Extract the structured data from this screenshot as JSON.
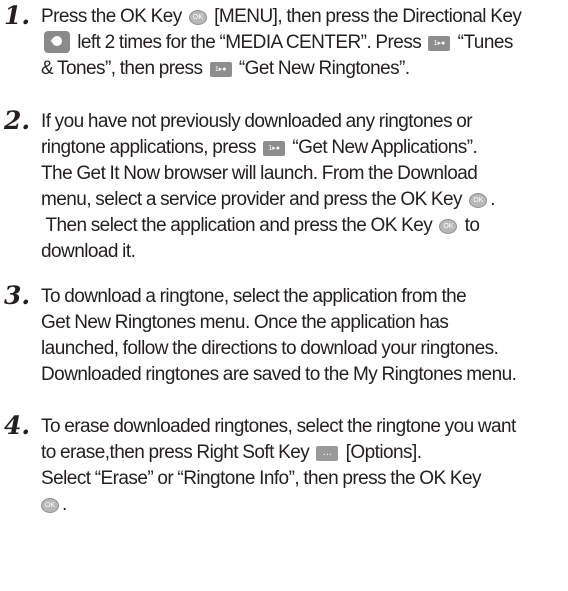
{
  "icons": {
    "ok_key": "ok-key-icon",
    "directional_key": "directional-key-icon",
    "number_key": "number-1-key-icon",
    "right_soft_key": "right-soft-key-icon"
  },
  "steps": [
    {
      "number": "1.",
      "l1a": "Press the OK Key ",
      "l1b": " [MENU], then press the Directional Key",
      "l2a": " left 2 times for the “MEDIA CENTER”. Press ",
      "l2b": " “Tunes",
      "l3a": "& Tones”, then press ",
      "l3b": " “Get New Ringtones”."
    },
    {
      "number": "2.",
      "l1": "If you have not previously downloaded any ringtones or",
      "l2a": "ringtone applications, press ",
      "l2b": " “Get New Applications”.",
      "l3": "The Get It Now browser will launch. From the Download",
      "l4a": "menu, select a service provider and press the OK Key ",
      "l4b": ".",
      "l5a": " Then select the application and press the OK Key ",
      "l5b": " to",
      "l6": "download it."
    },
    {
      "number": "3.",
      "l1": "To download a ringtone, select the application from the",
      "l2": "Get New Ringtones menu. Once the application has",
      "l3": "launched, follow the directions to download your ringtones.",
      "l4": "Downloaded ringtones are saved to the My Ringtones menu."
    },
    {
      "number": "4.",
      "l1": "To erase downloaded ringtones, select the ringtone you want",
      "l2a": "to erase,then press Right Soft Key ",
      "l2b": " [Options].",
      "l3": "Select “Erase” or “Ringtone Info”, then press the OK Key",
      "l4b": "."
    }
  ]
}
